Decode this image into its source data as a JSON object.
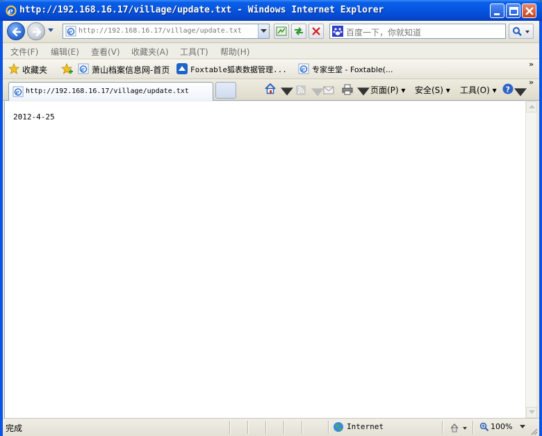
{
  "window": {
    "title": "http://192.168.16.17/village/update.txt - Windows Internet Explorer"
  },
  "navbar": {
    "address": "http://192.168.16.17/village/update.txt",
    "search_placeholder": "百度一下，你就知道"
  },
  "menubar": {
    "items": [
      "文件(F)",
      "编辑(E)",
      "查看(V)",
      "收藏夹(A)",
      "工具(T)",
      "帮助(H)"
    ]
  },
  "favorites": {
    "label": "收藏夹",
    "items": [
      "萧山档案信息网-首页",
      "Foxtable狐表数据管理...",
      "专家坐堂 - Foxtable(..."
    ]
  },
  "tabs": {
    "active_title": "http://192.168.16.17/village/update.txt"
  },
  "commandbar": {
    "page": "页面(P)",
    "safety": "安全(S)",
    "tools": "工具(O)"
  },
  "content": {
    "text": "2012-4-25"
  },
  "status": {
    "text": "完成",
    "zone": "Internet",
    "zoom": "100%"
  }
}
